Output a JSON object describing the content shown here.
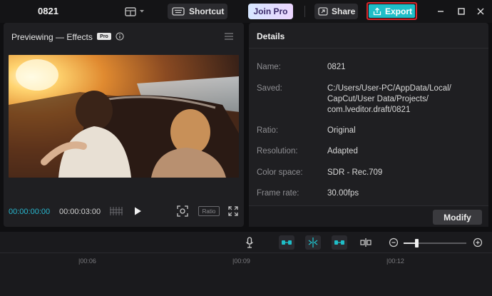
{
  "window": {
    "title": "0821",
    "shortcut_label": "Shortcut",
    "joinpro_label": "Join Pro",
    "share_label": "Share",
    "export_label": "Export",
    "accent_color": "#1fbec8"
  },
  "preview": {
    "title": "Previewing — Effects",
    "pro_badge": "Pro",
    "current_time": "00:00:00:00",
    "total_time": "00:00:03:00",
    "ratio_label": "Ratio"
  },
  "details": {
    "title": "Details",
    "rows": [
      {
        "label": "Name:",
        "value": "0821"
      },
      {
        "label": "Saved:",
        "value_lines": [
          "C:/Users/User-PC/AppData/Local/",
          "CapCut/User Data/Projects/",
          "com.lveditor.draft/0821"
        ]
      },
      {
        "label": "Ratio:",
        "value": "Original"
      },
      {
        "label": "Resolution:",
        "value": "Adapted"
      },
      {
        "label": "Color space:",
        "value": "SDR - Rec.709"
      },
      {
        "label": "Frame rate:",
        "value": "30.00fps"
      }
    ],
    "modify_label": "Modify"
  },
  "timeline": {
    "ruler_labels": [
      "|00:06",
      "|00:09",
      "|00:12"
    ],
    "zoom_level": 0.2
  }
}
